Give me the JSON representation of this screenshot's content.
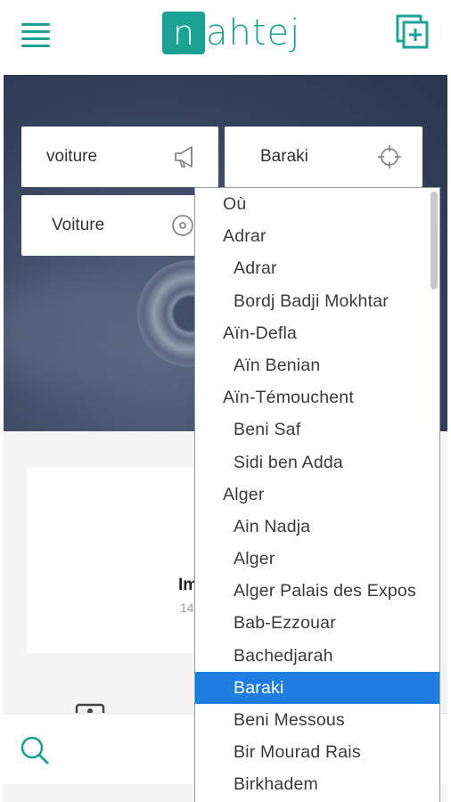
{
  "header": {
    "logo_letter": "n",
    "logo_text": "ahtej",
    "menu_icon": "hamburger-menu-icon",
    "add_icon": "add-post-icon"
  },
  "search_form": {
    "keyword": "voiture",
    "location": "Baraki",
    "category": "Voiture",
    "keyword_icon": "megaphone-icon",
    "location_icon": "crosshair-icon",
    "category_icon": "disc-icon"
  },
  "listing": {
    "title": "Im",
    "subtitle": "14"
  },
  "bottom_bar": {
    "search_icon": "search-icon"
  },
  "location_dropdown": {
    "selected": "Baraki",
    "items": [
      {
        "label": "Où",
        "level": "group"
      },
      {
        "label": "Adrar",
        "level": "group"
      },
      {
        "label": "Adrar",
        "level": "child"
      },
      {
        "label": "Bordj Badji Mokhtar",
        "level": "child"
      },
      {
        "label": "Aïn-Defla",
        "level": "group"
      },
      {
        "label": "Aïn Benian",
        "level": "child"
      },
      {
        "label": "Aïn-Témouchent",
        "level": "group"
      },
      {
        "label": "Beni Saf",
        "level": "child"
      },
      {
        "label": "Sidi ben Adda",
        "level": "child"
      },
      {
        "label": "Alger",
        "level": "group"
      },
      {
        "label": "Ain Nadja",
        "level": "child"
      },
      {
        "label": "Alger",
        "level": "child"
      },
      {
        "label": "Alger Palais des Expos",
        "level": "child"
      },
      {
        "label": "Bab-Ezzouar",
        "level": "child"
      },
      {
        "label": "Bachedjarah",
        "level": "child"
      },
      {
        "label": "Baraki",
        "level": "child"
      },
      {
        "label": "Beni Messous",
        "level": "child"
      },
      {
        "label": "Bir Mourad Rais",
        "level": "child"
      },
      {
        "label": "Birkhadem",
        "level": "child"
      }
    ]
  },
  "colors": {
    "brand": "#1aa394",
    "selection": "#1e7de0"
  }
}
